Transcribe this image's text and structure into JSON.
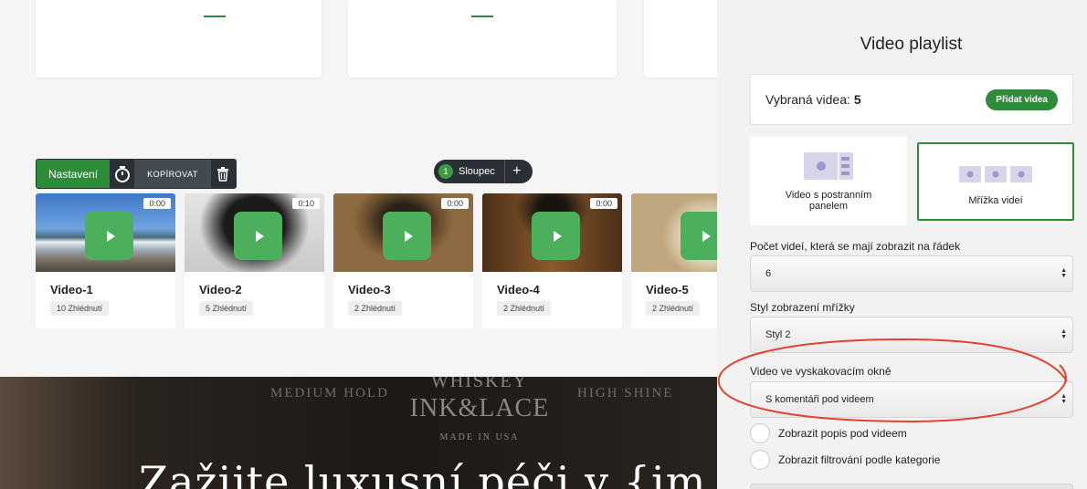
{
  "toolbar": {
    "settings_label": "Nastavení",
    "copy_label": "KOPÍROVAT"
  },
  "column_pill": {
    "count": "1",
    "label": "Sloupec",
    "plus": "+"
  },
  "videos": [
    {
      "title": "Video-1",
      "views": "10 Zhlédnutí",
      "duration": "0:00"
    },
    {
      "title": "Video-2",
      "views": "5 Zhlédnutí",
      "duration": "0:10"
    },
    {
      "title": "Video-3",
      "views": "2 Zhlédnutí",
      "duration": "0:00"
    },
    {
      "title": "Video-4",
      "views": "2 Zhlédnutí",
      "duration": "0:00"
    },
    {
      "title": "Video-5",
      "views": "2 Zhlédnutí",
      "duration": ""
    }
  ],
  "hero": {
    "left_tag": "MEDIUM HOLD",
    "right_tag": "HIGH SHINE",
    "brand_top": "WHISKEY",
    "brand_main": "INK&LACE",
    "brand_sub": "MADE IN USA",
    "title": "Zažijte luxusní péči v {im"
  },
  "panel": {
    "title": "Video playlist",
    "selected_label": "Vybraná videa:",
    "selected_count": "5",
    "add_button": "Přidat videa",
    "layout_sidebar": "Video s postranním panelem",
    "layout_grid": "Mřížka videí",
    "per_row_label": "Počet videí, která se mají zobrazit na řádek",
    "per_row_value": "6",
    "grid_style_label": "Styl zobrazení mřížky",
    "grid_style_value": "Styl 2",
    "popup_label": "Video ve vyskakovacím okně",
    "popup_value": "S komentáři pod videem",
    "show_description": "Zobrazit popis pod videem",
    "show_filter": "Zobrazit filtrování podle kategorie"
  },
  "colors": {
    "accent": "#2e8b3a",
    "play": "#4caf5b",
    "annotation": "#e0432e",
    "toolbar": "#2b2f36"
  }
}
